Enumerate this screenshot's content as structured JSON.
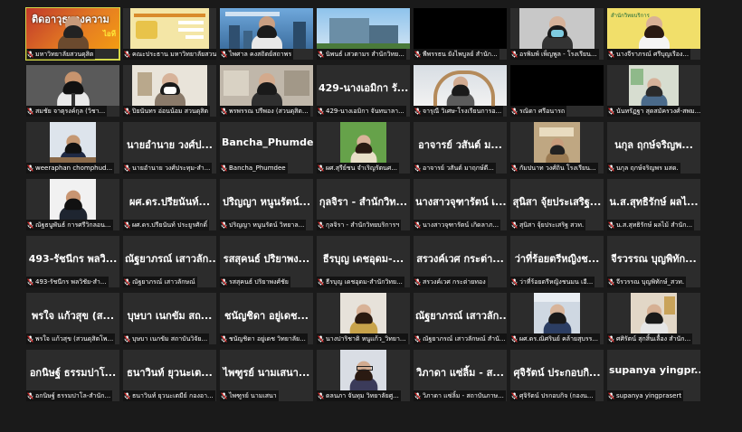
{
  "tiles": [
    {
      "label": "มหาวิทยาลัยสวนดุสิต",
      "kind": "video",
      "video": "banner-orange",
      "active": true
    },
    {
      "label": "คณะประธาน มหาวิทยาลัยสวนดุสิต",
      "kind": "video",
      "video": "slide-yellow"
    },
    {
      "label": "ไพศาล คงสถิตย์สถาพร",
      "kind": "video",
      "video": "city-blue"
    },
    {
      "label": "นิพนธ์ เสวตามร สำนักวิทย...",
      "kind": "video",
      "video": "building"
    },
    {
      "label": "พีพรรธน ยังไพบูลย์ สำนัก...",
      "kind": "video",
      "video": "dark"
    },
    {
      "label": "อรพิมพ์ เพ็ญพูล - โรงเรียน...",
      "kind": "video",
      "video": "mask-woman"
    },
    {
      "label": "นางจีราภรณ์ ศรีบุญเรือง...",
      "kind": "video",
      "video": "yellow-woman"
    },
    {
      "label": "สมชัย จาตุรงค์กุล (วิชา...",
      "kind": "video",
      "video": "man-tie"
    },
    {
      "label": "ปิยนันทร อ่อนน้อม สวนดุสิต",
      "kind": "video",
      "video": "mask-office"
    },
    {
      "label": "พรพรรณ ปรีพอง (สวนดุสิต...",
      "kind": "video",
      "video": "woman-hall"
    },
    {
      "label": "429-นางเอมิกา จันทนาลา...",
      "kind": "name",
      "big": "429-นางเอมิกา รั..."
    },
    {
      "label": "จารุณี วิเศษ-โรงเรียนการอ...",
      "kind": "video",
      "video": "arch"
    },
    {
      "label": "รณิดา ศรีอนารถ",
      "kind": "video",
      "video": "black"
    },
    {
      "label": "นันทรัฏฐา สุดสมัครวงศ์-สพม...",
      "kind": "video",
      "video": "green-room"
    },
    {
      "label": "weeraphan chomphud...",
      "kind": "video",
      "video": "desk-man",
      "small": true
    },
    {
      "label": "นายอำนาย วงศ์ประทุม-สำ...",
      "kind": "name",
      "big": "นายอำนาย วงศ์ป..."
    },
    {
      "label": "Bancha_Phumdee",
      "kind": "name",
      "big": "Bancha_Phumdee"
    },
    {
      "label": "ผศ.สุรีย์ชน จำเริญรัตนศ...",
      "kind": "video",
      "video": "green-woman",
      "small": true
    },
    {
      "label": "อาจารย์ วสันต์ มาฤกษ์ดี...",
      "kind": "name",
      "big": "อาจารย์ วสันต์ ม..."
    },
    {
      "label": "กัมปนาท วงศ์ถิน โรงเรียน...",
      "kind": "video",
      "video": "room-group",
      "small": true
    },
    {
      "label": "นกุล ฤกษ์จริญพร มสด.",
      "kind": "name",
      "big": "นกุล ฤกษ์จริญพ..."
    },
    {
      "label": "ณัฐธนูพันธ์ การศรีวิกลอน...",
      "kind": "video",
      "video": "portrait-man",
      "small": true
    },
    {
      "label": "ผศ.ดร.ปรียนันท์ ประยูรศักดิ์",
      "kind": "name",
      "big": "ผศ.ดร.ปรียนันท์..."
    },
    {
      "label": "ปริญญา หนูนรัตน์ วิทยาล...",
      "kind": "name",
      "big": "ปริญญา หนูนรัตน์..."
    },
    {
      "label": "กุลจิรา - สำนักวิทยบริการฯ",
      "kind": "name",
      "big": "กุลจิรา - สำนักวิท..."
    },
    {
      "label": "นางสาวจุฑารัตน์ เกิดลาภ...",
      "kind": "name",
      "big": "นางสาวจุฑารัตน์ เ..."
    },
    {
      "label": "สุนิสา จุ้ยประเสริฐ สวท.",
      "kind": "name",
      "big": "สุนิสา จุ้ยประเสริฐ..."
    },
    {
      "label": "น.ส.สุทธิรักษ์ ผลไม้ สำนัก...",
      "kind": "name",
      "big": "น.ส.สุทธิรักษ์ ผลไ..."
    },
    {
      "label": "493-รัชนีกร พลวิชัย-สำ...",
      "kind": "name",
      "big": "493-รัชนีกร พลวิ..."
    },
    {
      "label": "ณัฐยาภรณ์ เสาวลักษณ์",
      "kind": "name",
      "big": "ณัฐยาภรณ์ เสาวลัก..."
    },
    {
      "label": "รสสุคนธ์ ปริยาพงศ์ชัย",
      "kind": "name",
      "big": "รสสุคนธ์ ปริยาพง..."
    },
    {
      "label": "ธีรบุญ เดชอุดม-สำนักวิทย...",
      "kind": "name",
      "big": "ธีรบุญ เดชอุดม-..."
    },
    {
      "label": "สรวงค์เวศ กระต่ายทอง",
      "kind": "name",
      "big": "สรวงค์เวศ กระต่า..."
    },
    {
      "label": "ว่าที่ร้อยตรีหญิงชนมน เอี...",
      "kind": "name",
      "big": "ว่าที่ร้อยตรีหญิงช..."
    },
    {
      "label": "จีรวรรณ บุญพิทักษ์_สวท.",
      "kind": "name",
      "big": "จีรวรรณ บุญพิทัก..."
    },
    {
      "label": "พรใจ แก้วสุข (สวนดุสิตโพ...",
      "kind": "name",
      "big": "พรใจ แก้วสุข (ส..."
    },
    {
      "label": "บุษบา เนกขัม สถาบันวิจัย...",
      "kind": "name",
      "big": "บุษบา เนกขัม สถ..."
    },
    {
      "label": "ชนัญชิดา อยู่เดช วิทยาลัย...",
      "kind": "name",
      "big": "ชนัญชิดา อยู่เดช..."
    },
    {
      "label": "นางปาริชาติ หนูแก้ว_วิทยา...",
      "kind": "video",
      "video": "woman-plain",
      "small": true
    },
    {
      "label": "ณัฐยาภรณ์ เสาวลักษณ์ สำนั...",
      "kind": "name",
      "big": "ณัฐยาภรณ์ เสาวลัก..."
    },
    {
      "label": "ผศ.ดร.ณิศรินย์ คล้ายสุบรร...",
      "kind": "video",
      "video": "woman-office",
      "small": true
    },
    {
      "label": "ศศิรัตน์ สุกสิ้นเลื้อง สำนัก...",
      "kind": "video",
      "video": "woman-home",
      "small": true
    },
    {
      "label": "อกนิษฐ์ ธรรมปาโล-สำนัก...",
      "kind": "name",
      "big": "อกนิษฐ์ ธรรมปาโ..."
    },
    {
      "label": "ธนาวินท์ ยุวนะเตมีย์ กองอา...",
      "kind": "name",
      "big": "ธนาวินท์ ยุวนะเต..."
    },
    {
      "label": "ไพฑูรย์ นามเสนา",
      "kind": "name",
      "big": "ไพฑูรย์ นามเสนา..."
    },
    {
      "label": "ดลนภา จันทุม วิทยาลัยศู...",
      "kind": "video",
      "video": "woman-glasses",
      "small": true
    },
    {
      "label": "วิภาดา แซ่ลิ้ม - สถาบันภาษ...",
      "kind": "name",
      "big": "วิภาดา แซ่ลิ้ม - ส..."
    },
    {
      "label": "ศุจิรัตน์ ปรกอบกิจ (กองน...",
      "kind": "name",
      "big": "ศุจิรัตน์ ประกอบกิ..."
    },
    {
      "label": "supanya yingprasert",
      "kind": "name",
      "big": "supanya yingpr..."
    }
  ]
}
